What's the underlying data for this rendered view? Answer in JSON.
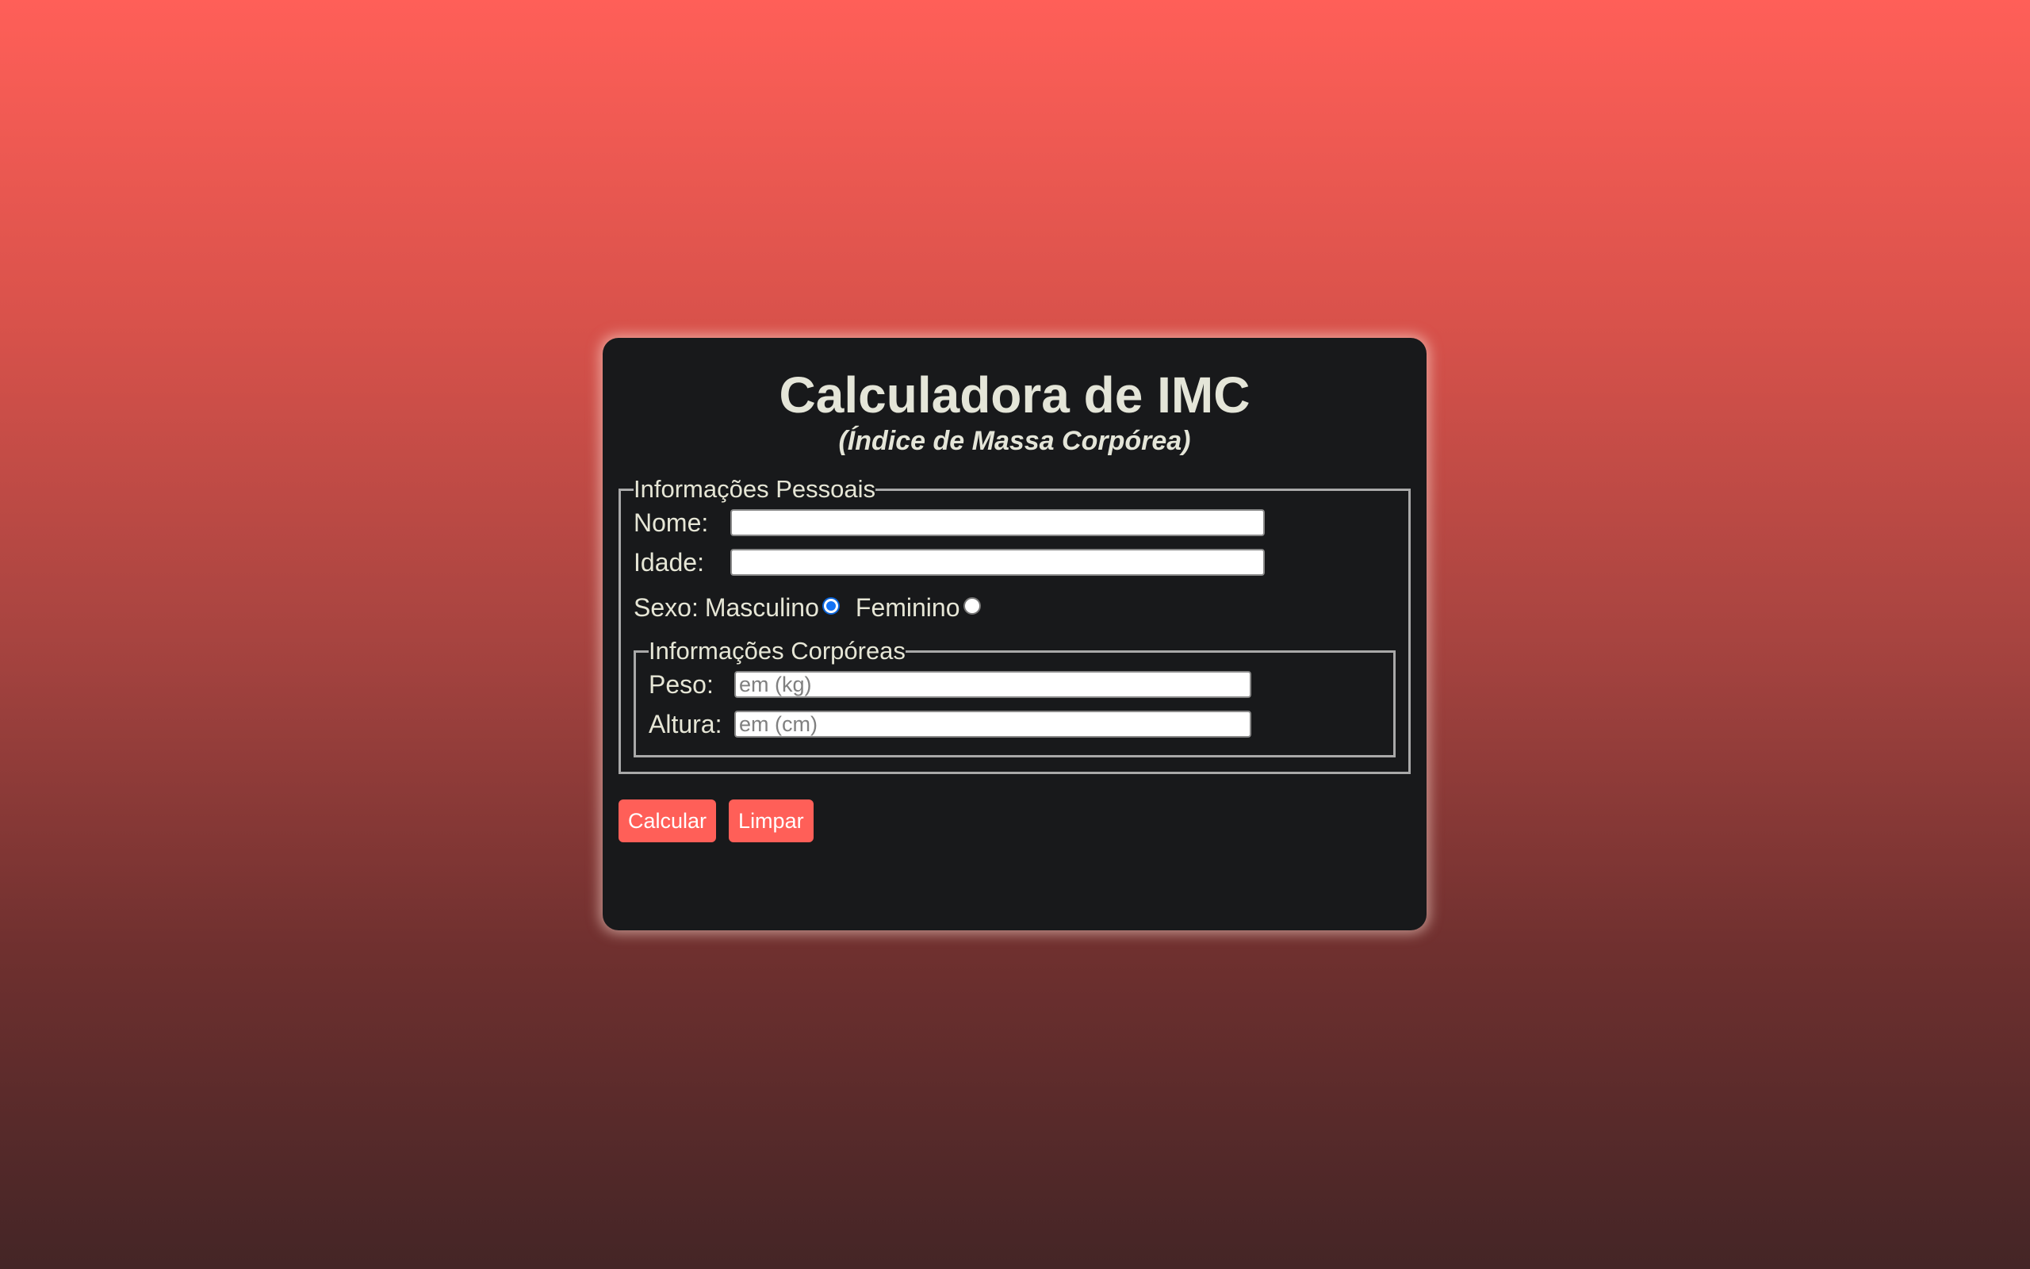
{
  "header": {
    "title": "Calculadora de IMC",
    "subtitle": "(Índice de Massa Corpórea)"
  },
  "personal": {
    "legend": "Informações Pessoais",
    "name_label": "Nome:",
    "name_value": "",
    "age_label": "Idade:",
    "age_value": "",
    "sex_label": "Sexo:",
    "sex_options": [
      "Masculino",
      "Feminino"
    ],
    "sex_selected": "Masculino"
  },
  "body": {
    "legend": "Informações Corpóreas",
    "weight_label": "Peso:",
    "weight_placeholder": "em (kg)",
    "height_label": "Altura:",
    "height_placeholder": "em (cm)"
  },
  "actions": {
    "calculate_label": "Calcular",
    "clear_label": "Limpar"
  },
  "colors": {
    "accent": "#ff5f58",
    "card_background": "#18191b",
    "text": "#e6e6d6"
  }
}
